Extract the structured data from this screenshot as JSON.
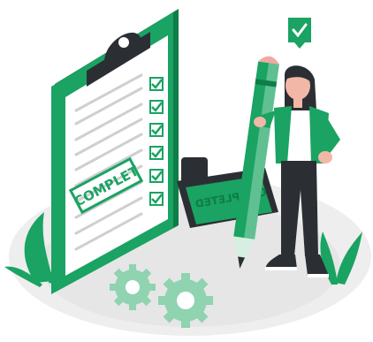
{
  "illustration": {
    "clipboard_stamp_text": "COMPLET",
    "rubber_stamp_text": "COMPLETED",
    "checklist": {
      "checked_items": 6
    },
    "colors": {
      "primary_green": "#1aa363",
      "dark_green": "#0e7d48",
      "light_green": "#8fd3b1",
      "pale_green": "#d6efe2",
      "dark_gray": "#2b2f33",
      "floor_gray": "#eeeeee",
      "pencil_tip": "#f3a7a3",
      "skin": "#f2b7a6"
    },
    "icons": [
      "check-badge-icon",
      "gear-icon",
      "gear-icon"
    ]
  }
}
